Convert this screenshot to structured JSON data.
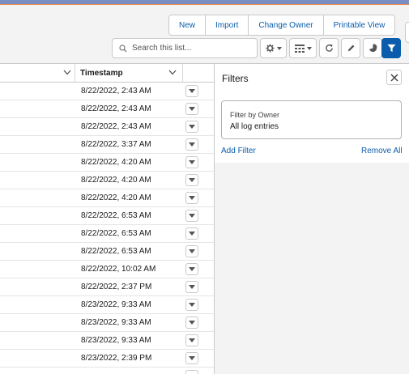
{
  "actions": {
    "buttons": [
      "New",
      "Import",
      "Change Owner",
      "Printable View"
    ]
  },
  "search": {
    "placeholder": "Search this list..."
  },
  "table": {
    "columns": [
      "",
      "Timestamp"
    ],
    "rows": [
      "8/22/2022, 2:43 AM",
      "8/22/2022, 2:43 AM",
      "8/22/2022, 2:43 AM",
      "8/22/2022, 3:37 AM",
      "8/22/2022, 4:20 AM",
      "8/22/2022, 4:20 AM",
      "8/22/2022, 4:20 AM",
      "8/22/2022, 6:53 AM",
      "8/22/2022, 6:53 AM",
      "8/22/2022, 6:53 AM",
      "8/22/2022, 10:02 AM",
      "8/22/2022, 2:37 PM",
      "8/23/2022, 9:33 AM",
      "8/23/2022, 9:33 AM",
      "8/23/2022, 9:33 AM",
      "8/23/2022, 2:39 PM"
    ]
  },
  "filters": {
    "title": "Filters",
    "card": {
      "label": "Filter by Owner",
      "value": "All log entries"
    },
    "add_filter": "Add Filter",
    "remove_all": "Remove All"
  },
  "colors": {
    "brand_blue": "#0b5cab",
    "header_bg": "#f3f3f3",
    "topbar": "#7b8ec4"
  },
  "icons": [
    "search-icon",
    "gear-icon",
    "table-view-icon",
    "refresh-icon",
    "pencil-icon",
    "chart-icon",
    "filter-icon",
    "close-icon",
    "chevron-down-icon"
  ]
}
